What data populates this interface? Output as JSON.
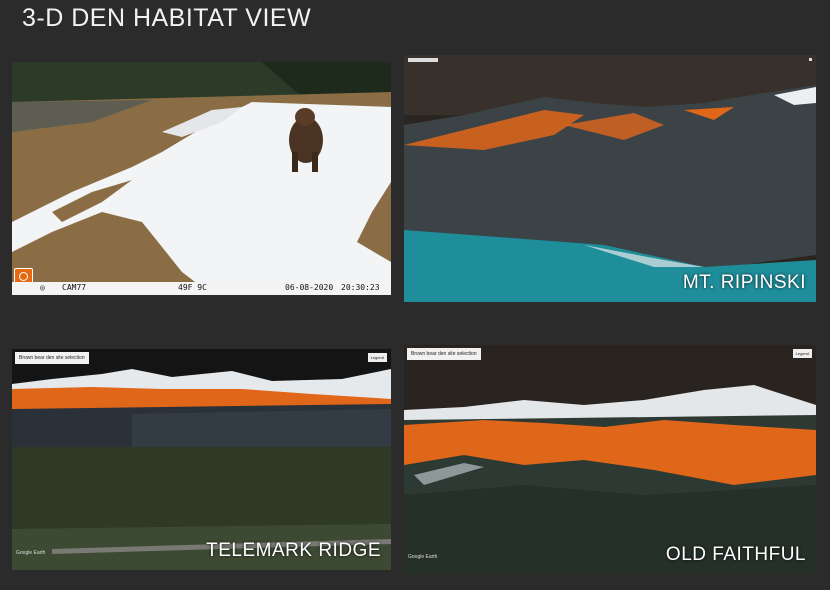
{
  "title": "3-D DEN HABITAT VIEW",
  "panels": {
    "camera": {
      "cam_id": "CAM77",
      "temperature": "49F 9C",
      "date": "06-08-2020",
      "time": "20:30:23"
    },
    "ripinski": {
      "label": "MT. RIPINSKI"
    },
    "telemark": {
      "label": "TELEMARK RIDGE",
      "tag": "Brown bear den site selection",
      "legend": "Legend",
      "attribution": "Google Earth"
    },
    "faithful": {
      "label": "OLD FAITHFUL",
      "tag": "Brown bear den site selection",
      "legend": "Legend",
      "attribution": "Google Earth"
    }
  },
  "colors": {
    "habitat": "#e0661a",
    "water": "#1f8e9b",
    "snow": "#f2f4f6"
  }
}
